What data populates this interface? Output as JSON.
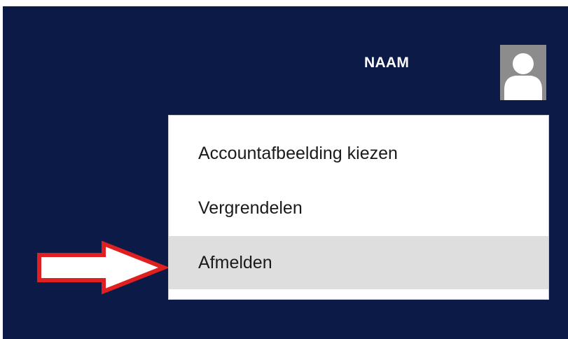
{
  "user": {
    "name": "NAAM",
    "avatar_icon": "user-silhouette-icon"
  },
  "account_menu": {
    "items": [
      {
        "label": "Accountafbeelding kiezen",
        "selected": false
      },
      {
        "label": "Vergrendelen",
        "selected": false
      },
      {
        "label": "Afmelden",
        "selected": true
      }
    ]
  },
  "annotation": {
    "icon": "right-arrow-icon",
    "outline_color": "#e02020",
    "fill_color": "#ffffff"
  },
  "colors": {
    "background": "#0b1a47",
    "menu_background": "#ffffff",
    "highlight": "#dedede",
    "avatar_background": "#8c8c8c"
  }
}
